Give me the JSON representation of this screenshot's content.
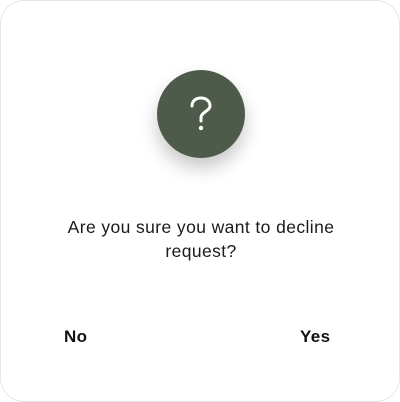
{
  "dialog": {
    "icon": "question-mark-icon",
    "icon_color": "#4e5a4a",
    "message": "Are you sure you want to decline request?",
    "no_label": "No",
    "yes_label": "Yes"
  }
}
